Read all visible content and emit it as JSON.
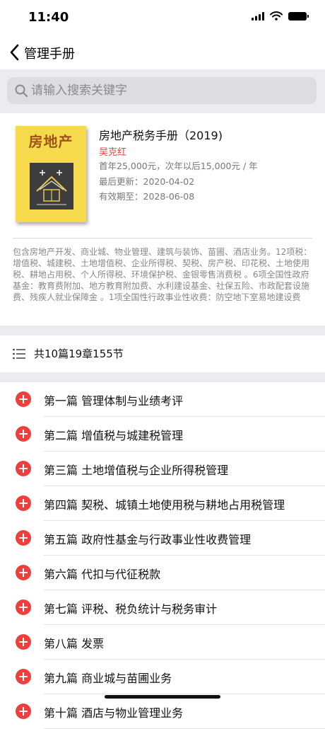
{
  "status_bar": {
    "time": "11:40"
  },
  "nav": {
    "title": "管理手册"
  },
  "search": {
    "placeholder": "请输入搜索关键字"
  },
  "book": {
    "cover_title": "房地产",
    "title": "房地产税务手册（2019)",
    "author": "吴克红",
    "price": "首年25,000元，次年以后15,000元 / 年",
    "last_update": "最后更新：2020-04-02",
    "expires": "有效期至：2028-06-08",
    "description": "包含房地产开发、商业城、物业管理、建筑与装饰、苗圃、酒店业务。12项税：增值税、城建税、土地增值税、企业所得税、契税、房产税、印花税、土地使用税、耕地占用税、个人所得税、环境保护税、金银零售消费税 。6项全国性政府基金：教育费附加、地方教育附加费、水利建设基金、社保五险、市政配套设施费、残疾人就业保障金 。1项全国性行政事业性收费：防空地下室易地建设费"
  },
  "summary": {
    "text": "共10篇19章155节"
  },
  "chapters": [
    {
      "label": "第一篇 管理体制与业绩考评"
    },
    {
      "label": "第二篇 增值税与城建税管理"
    },
    {
      "label": "第三篇 土地增值税与企业所得税管理"
    },
    {
      "label": "第四篇 契税、城镇土地使用税与耕地占用税管理"
    },
    {
      "label": "第五篇 政府性基金与行政事业性收费管理"
    },
    {
      "label": "第六篇 代扣与代征税款"
    },
    {
      "label": "第七篇 评税、税负统计与税务审计"
    },
    {
      "label": "第八篇 发票"
    },
    {
      "label": "第九篇 商业城与苗圃业务"
    },
    {
      "label": "第十篇 酒店与物业管理业务"
    }
  ],
  "colors": {
    "accent_red": "#ee3f3c",
    "cover_yellow": "#f7da4c",
    "group_bg": "#ececf0"
  }
}
